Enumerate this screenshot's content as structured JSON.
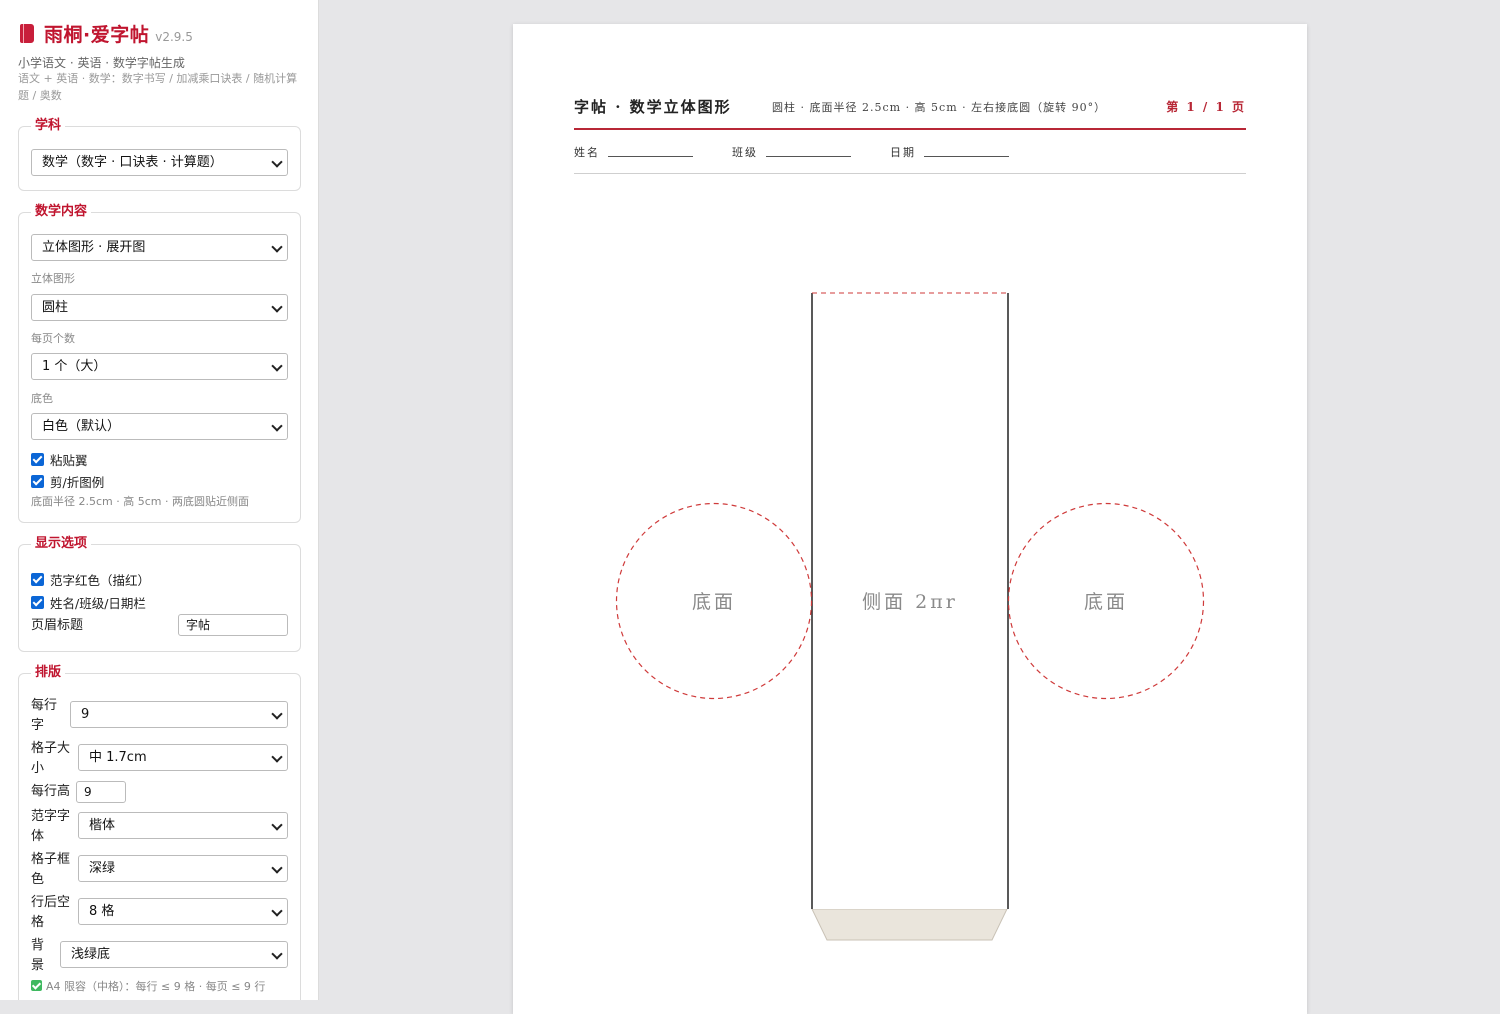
{
  "app": {
    "name": "雨桐·爱字帖",
    "version": "v2.9.5",
    "subtitle": "小学语文 · 英语 · 数学字帖生成",
    "description": "语文 + 英语 · 数学：数字书写 / 加减乘口诀表 / 随机计算题 / 奥数"
  },
  "panels": {
    "subject": {
      "title": "学科",
      "select": "数学（数字 · 口诀表 · 计算题）"
    },
    "math": {
      "title": "数学内容",
      "content_select": "立体图形 · 展开图",
      "shape_label": "立体图形",
      "shape_select": "圆柱",
      "per_page_label": "每页个数",
      "per_page_select": "1 个（大）",
      "bg_label": "底色",
      "bg_select": "白色（默认）",
      "glue_tab_label": "粘贴翼",
      "cut_fold_label": "剪/折图例",
      "hint": "底面半径 2.5cm · 高 5cm · 两底圆贴近侧面"
    },
    "display": {
      "title": "显示选项",
      "red_trace_label": "范字红色（描红）",
      "name_bar_label": "姓名/班级/日期栏",
      "header_title_label": "页眉标题",
      "header_title_value": "字帖"
    },
    "layout": {
      "title": "排版",
      "chars_per_row_label": "每行字",
      "chars_per_row_value": "9",
      "cell_size_label": "格子大小",
      "cell_size_value": "中 1.7cm",
      "row_height_label": "每行高",
      "row_height_value": "9",
      "font_label": "范字字体",
      "font_value": "楷体",
      "grid_color_label": "格子框色",
      "grid_color_value": "深绿",
      "blank_label": "行后空格",
      "blank_value": "8 格",
      "background_label": "背景",
      "background_value": "浅绿底",
      "capacity_note": "A4 限容（中格）：每行 ≤ 9 格 · 每页 ≤ 9 行"
    }
  },
  "paper": {
    "header_title": "字帖 · 数学立体图形",
    "header_meta": "圆柱 · 底面半径 2.5cm · 高 5cm · 左右接底圆（旋转 90°）",
    "page_label": "第 1 / 1 页",
    "name_field": "姓名",
    "class_field": "班级",
    "date_field": "日期",
    "net": {
      "side_label": "侧面 2πr",
      "left_base_label": "底面",
      "right_base_label": "底面"
    }
  },
  "colors": {
    "brand": "#c0152f",
    "header_rule": "#b82736",
    "cut_line": "#cf3a3a",
    "glue_tab": "#eae5dc",
    "checkbox": "#0b66d6"
  }
}
